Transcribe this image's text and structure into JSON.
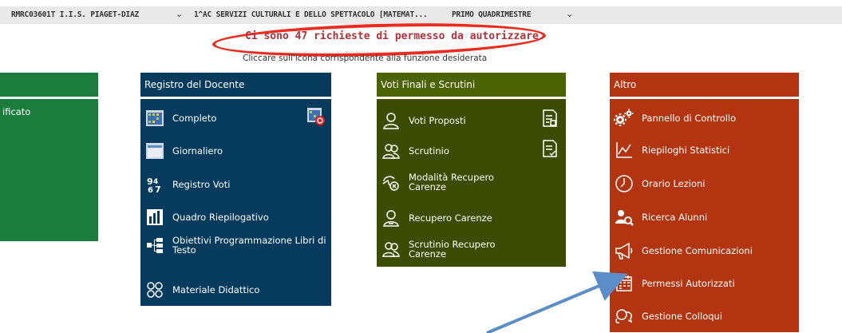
{
  "topbar": {
    "school": "RMRC03601T I.I.S. PIAGET-DIAZ",
    "classe": "1^AC SERVIZI CULTURALI E DELLO SPETTACOLO [MATEMAT...",
    "period": "PRIMO QUADRIMESTRE"
  },
  "alert": {
    "message": "Ci sono 47 richieste di permesso da autorizzare.",
    "ring_color": "#ee2a1e"
  },
  "instruction": "Cliccare sull'icona corrispondente alla funzione desiderata",
  "panels": {
    "green": {
      "color": "#1b7c3e",
      "items": [
        "ificato"
      ]
    },
    "docente": {
      "title": "Registro del Docente",
      "color": "#063b5d",
      "items": [
        "Completo",
        "Giornaliero",
        "Registro Voti",
        "Quadro Riepilogativo",
        "Obiettivi Programmazione Libri di Testo",
        "Materiale Didattico"
      ]
    },
    "voti": {
      "title": "Voti Finali e Scrutini",
      "color": "#4c6304",
      "items": [
        "Voti Proposti",
        "Scrutinio",
        "Modalità Recupero Carenze",
        "Recupero Carenze",
        "Scrutinio Recupero Carenze"
      ]
    },
    "altro": {
      "title": "Altro",
      "color": "#b23410",
      "items": [
        "Pannello di Controllo",
        "Riepiloghi Statistici",
        "Orario Lezioni",
        "Ricerca Alunni",
        "Gestione Comunicazioni",
        "Permessi Autorizzati",
        "Gestione Colloqui"
      ]
    }
  },
  "annotation": {
    "arrow_color": "#5b8ec9"
  }
}
